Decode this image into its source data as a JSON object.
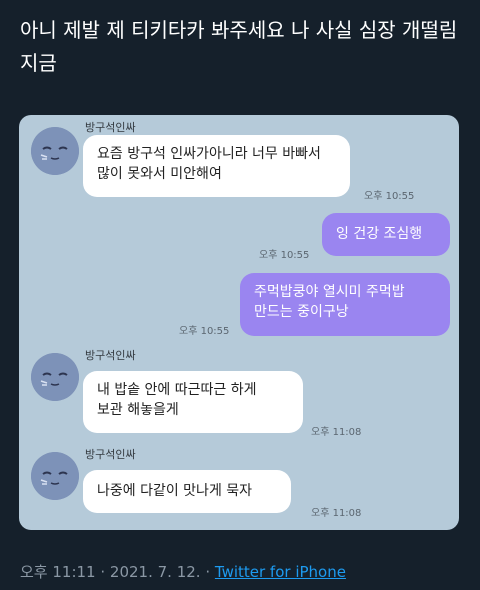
{
  "tweet": {
    "text": "아니 제발 제 티키타카 봐주세요 나 사실 심장 개떨림 지금"
  },
  "chat": {
    "sender_name": "방구석인싸",
    "messages": [
      {
        "text_line1": "요즘 방구석 인싸가아니라 너무 바빠서",
        "text_line2": "많이 못와서 미안해여",
        "time": "오후 10:55"
      },
      {
        "text": "잉 건강 조심행",
        "time": "오후 10:55"
      },
      {
        "text_line1": "주먹밥쿵야 열시미 주먹밥",
        "text_line2": "만드는 중이구낭",
        "time": "오후 10:55"
      },
      {
        "text_line1": "내 밥솥 안에 따근따근 하게",
        "text_line2": "보관 해놓을게",
        "time": "오후 11:08"
      },
      {
        "text": "나중에 다같이 맛나게 묵자",
        "time": "오후 11:08"
      }
    ]
  },
  "footer": {
    "time": "오후 11:11",
    "sep1": " · ",
    "date": "2021. 7. 12.",
    "sep2": " · ",
    "source": "Twitter for iPhone"
  }
}
